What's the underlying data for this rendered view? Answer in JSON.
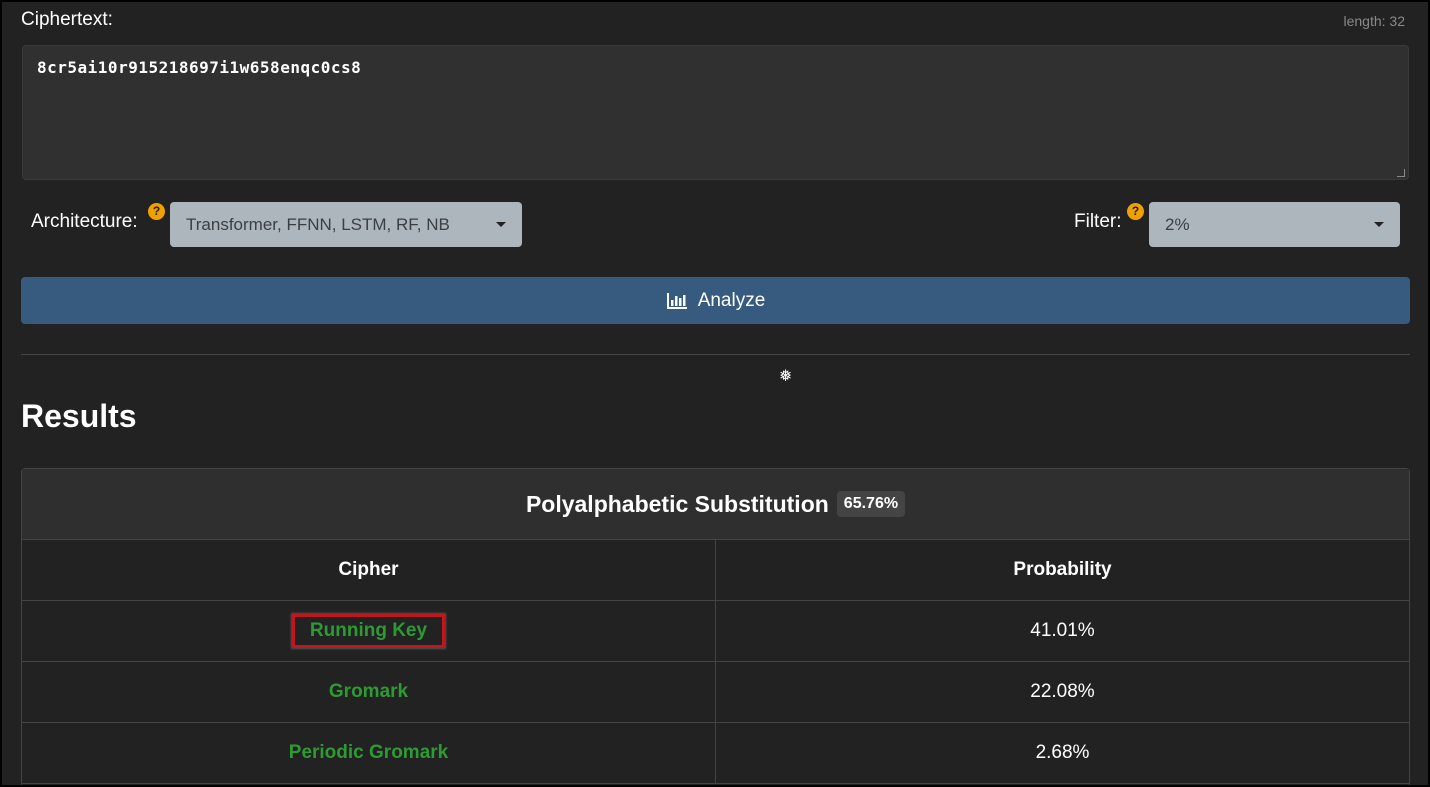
{
  "input": {
    "label": "Ciphertext:",
    "length_text": "length: 32",
    "value": "8cr5ai10r915218697i1w658enqc0cs8"
  },
  "controls": {
    "architecture_label": "Architecture:",
    "architecture_value": "Transformer, FFNN, LSTM, RF, NB",
    "filter_label": "Filter:",
    "filter_value": "2%",
    "help_glyph": "?",
    "analyze_label": "Analyze"
  },
  "decor": {
    "snowflake": "❅",
    "snowflake_alt": "❆"
  },
  "results": {
    "title": "Results",
    "group_title": "Polyalphabetic Substitution",
    "group_probability": "65.76%",
    "col_cipher": "Cipher",
    "col_probability": "Probability",
    "rows": [
      {
        "cipher": "Running Key",
        "probability": "41.01%"
      },
      {
        "cipher": "Gromark",
        "probability": "22.08%"
      },
      {
        "cipher": "Periodic Gromark",
        "probability": "2.68%"
      }
    ]
  },
  "colors": {
    "background": "#222222",
    "primary_button": "#375a7f",
    "select_bg": "#adb5bd",
    "link_green": "#2e9a33",
    "help_orange": "#f0a000",
    "highlight_red": "#c0161e"
  }
}
